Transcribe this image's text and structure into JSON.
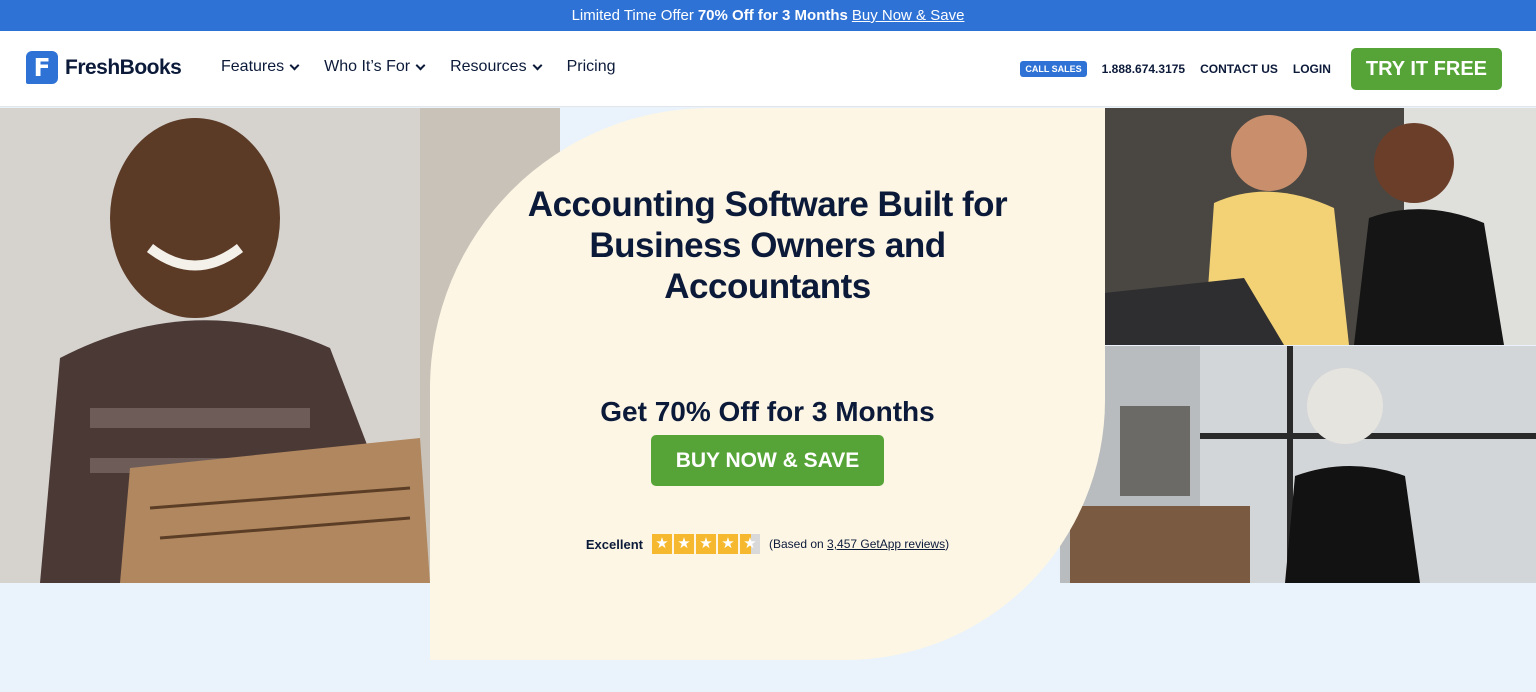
{
  "promo": {
    "prefix": "Limited Time Offer",
    "highlight": "70% Off for 3 Months",
    "link": "Buy Now & Save"
  },
  "nav": {
    "logo_text": "FreshBooks",
    "menu": [
      "Features",
      "Who It’s For",
      "Resources",
      "Pricing"
    ],
    "call_sales": "CALL SALES",
    "phone": "1.888.674.3175",
    "contact": "CONTACT US",
    "login": "LOGIN",
    "cta": "TRY IT FREE"
  },
  "hero": {
    "headline_line1": "Accounting Software Built for",
    "headline_line2": "Business Owners and",
    "headline_line3": "Accountants",
    "offer": "Get 70% Off for 3 Months",
    "cta": "BUY NOW & SAVE",
    "rating_label": "Excellent",
    "rating_prefix": "(Based on ",
    "rating_link": "3,457 GetApp reviews",
    "rating_suffix": ")"
  },
  "colors": {
    "promo_bg": "#2f72d5",
    "cta_green": "#56a437",
    "cream": "#fdf6e4",
    "navy": "#0c1a3a",
    "star": "#f5b82e"
  }
}
